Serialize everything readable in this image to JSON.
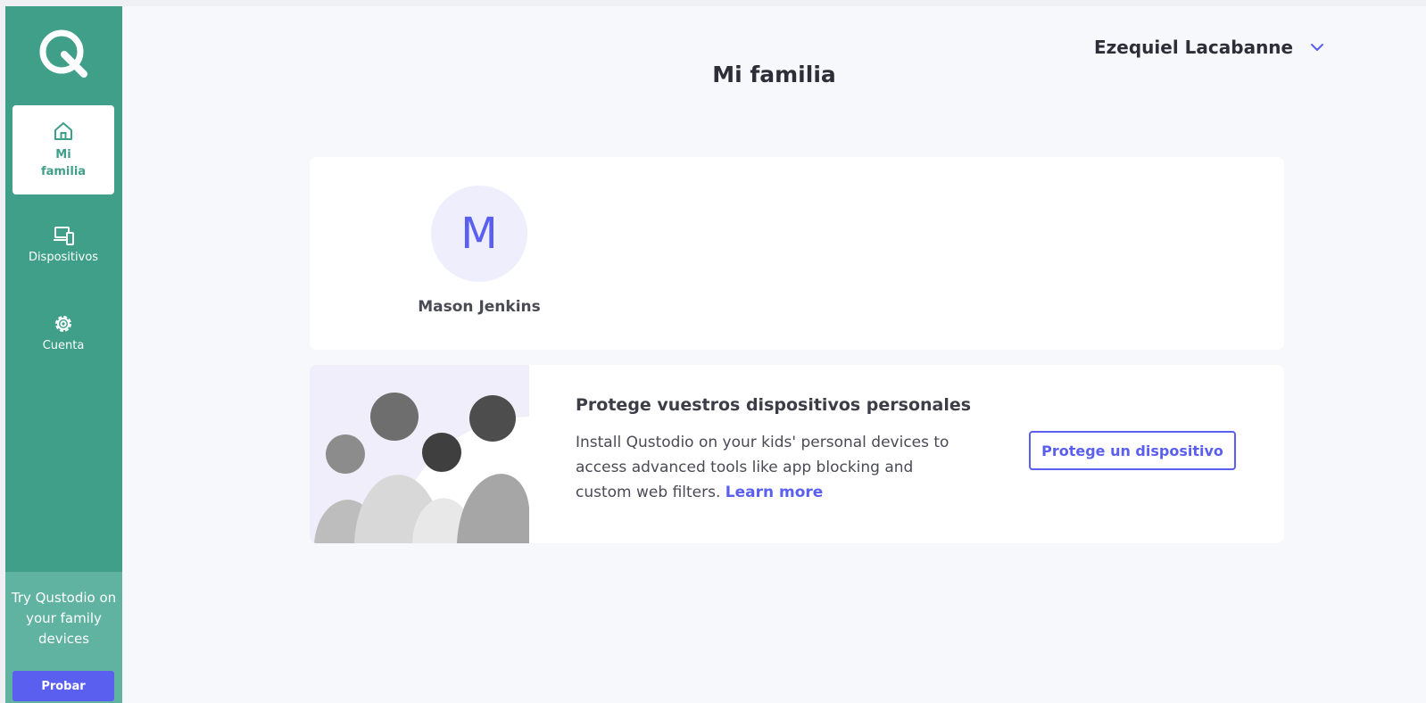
{
  "sidebar": {
    "logo_icon": "qustodio-logo-icon",
    "items": [
      {
        "label": "Mi familia",
        "icon": "home-icon",
        "active": true
      },
      {
        "label": "Dispositivos",
        "icon": "devices-icon",
        "active": false
      },
      {
        "label": "Cuenta",
        "icon": "gear-icon",
        "active": false
      }
    ],
    "promo": {
      "text": "Try Qustodio on your family devices",
      "button_label": "Probar"
    }
  },
  "header": {
    "user_name": "Ezequiel Lacabanne",
    "title": "Mi familia"
  },
  "family": {
    "members": [
      {
        "initial": "M",
        "name": "Mason Jenkins"
      }
    ]
  },
  "banner": {
    "title": "Protege vuestros dispositivos personales",
    "description": "Install Qustodio on your kids' personal devices to access advanced tools like app blocking and custom web filters.",
    "link_label": "Learn more",
    "button_label": "Protege un dispositivo"
  },
  "colors": {
    "sidebar": "#3f9f89",
    "accent": "#5a5ff0",
    "background": "#f7f8fb"
  }
}
